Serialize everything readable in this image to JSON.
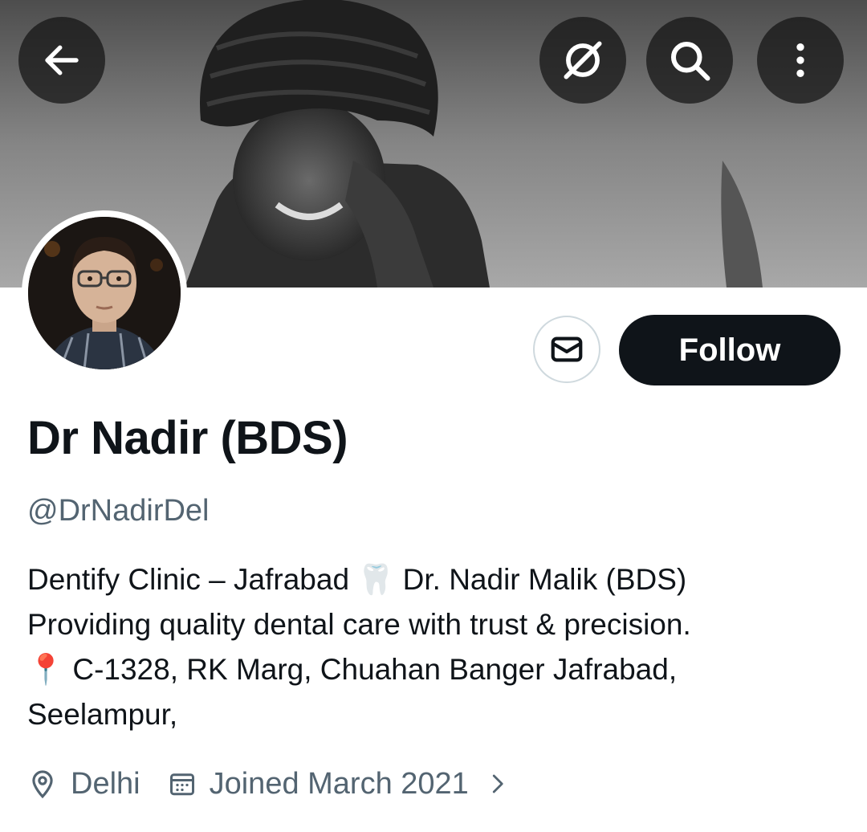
{
  "header": {
    "back_icon": "arrow-left-icon",
    "grok_icon": "slashed-circle-icon",
    "search_icon": "search-icon",
    "more_icon": "more-vertical-icon"
  },
  "profile": {
    "name": "Dr Nadir (BDS)",
    "handle": "@DrNadirDel",
    "bio_lines": [
      "Dentify Clinic – Jafrabad 🦷 Dr. Nadir Malik (BDS)",
      "Providing quality dental care with trust & precision.",
      "📍 C-1328, RK Marg, Chuahan Banger Jafrabad,",
      "Seelampur,"
    ],
    "location": "Delhi",
    "joined": "Joined March 2021"
  },
  "actions": {
    "message_icon": "envelope-icon",
    "follow_label": "Follow"
  },
  "colors": {
    "primary_text": "#0f1419",
    "secondary_text": "#536471",
    "follow_bg": "#0f1419",
    "border": "#cfd9de"
  }
}
